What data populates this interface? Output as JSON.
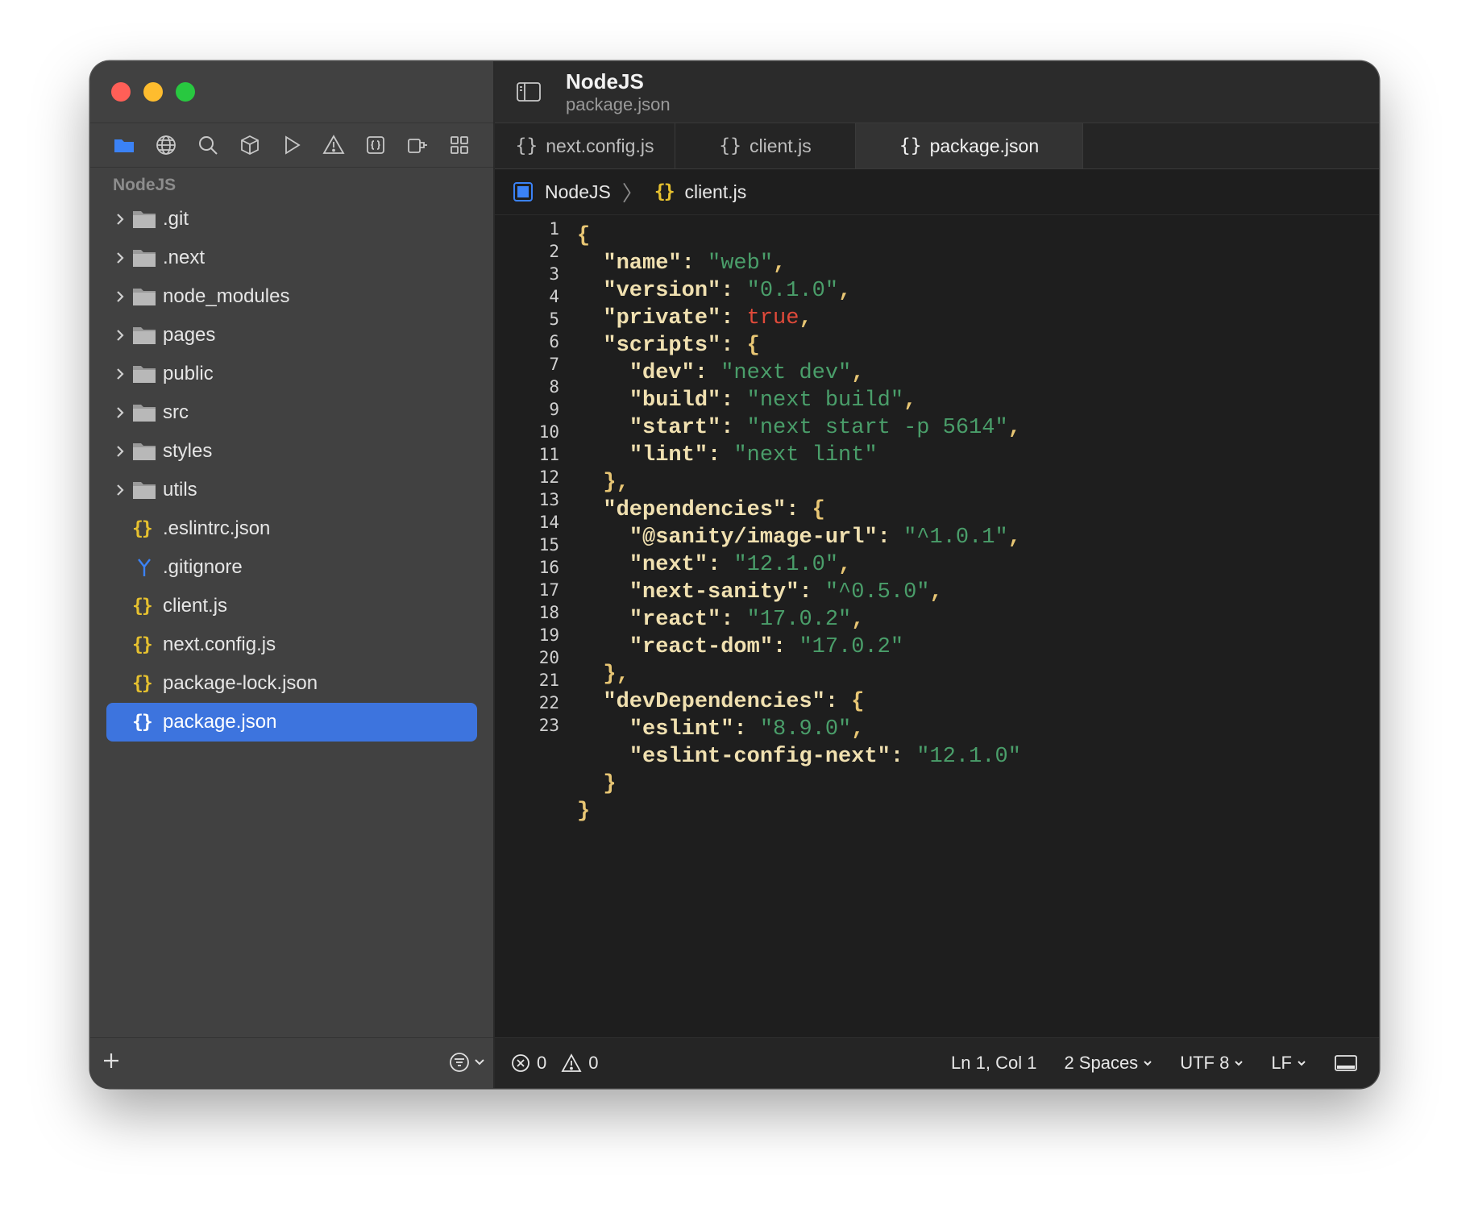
{
  "window": {
    "project_title": "NodeJS",
    "file_subtitle": "package.json"
  },
  "sidebar": {
    "project_label": "NodeJS",
    "navbar_icons": [
      "folder-icon",
      "globe-icon",
      "search-icon",
      "package-icon",
      "run-icon",
      "warning-icon",
      "braces-icon",
      "plug-icon",
      "grid-icon"
    ],
    "items": [
      {
        "label": ".git",
        "type": "folder"
      },
      {
        "label": ".next",
        "type": "folder"
      },
      {
        "label": "node_modules",
        "type": "folder"
      },
      {
        "label": "pages",
        "type": "folder"
      },
      {
        "label": "public",
        "type": "folder"
      },
      {
        "label": "src",
        "type": "folder"
      },
      {
        "label": "styles",
        "type": "folder"
      },
      {
        "label": "utils",
        "type": "folder"
      },
      {
        "label": ".eslintrc.json",
        "type": "json"
      },
      {
        "label": ".gitignore",
        "type": "git"
      },
      {
        "label": "client.js",
        "type": "json"
      },
      {
        "label": "next.config.js",
        "type": "json"
      },
      {
        "label": "package-lock.json",
        "type": "json"
      },
      {
        "label": "package.json",
        "type": "json",
        "selected": true
      }
    ],
    "braces_glyph": "{}"
  },
  "tabs": [
    {
      "label": "next.config.js"
    },
    {
      "label": "client.js"
    },
    {
      "label": "package.json",
      "active": true
    }
  ],
  "breadcrumb": {
    "project": "NodeJS",
    "file": "client.js"
  },
  "editor": {
    "line_numbers": [
      "1",
      "2",
      "3",
      "4",
      "5",
      "6",
      "7",
      "8",
      "9",
      "10",
      "11",
      "12",
      "13",
      "14",
      "15",
      "16",
      "17",
      "18",
      "19",
      "20",
      "21",
      "22",
      "23"
    ],
    "lines": [
      "{",
      "  \"name\": \"web\",",
      "  \"version\": \"0.1.0\",",
      "  \"private\": true,",
      "  \"scripts\": {",
      "    \"dev\": \"next dev\",",
      "    \"build\": \"next build\",",
      "    \"start\": \"next start -p 5614\",",
      "    \"lint\": \"next lint\"",
      "  },",
      "  \"dependencies\": {",
      "    \"@sanity/image-url\": \"^1.0.1\",",
      "    \"next\": \"12.1.0\",",
      "    \"next-sanity\": \"^0.5.0\",",
      "    \"react\": \"17.0.2\",",
      "    \"react-dom\": \"17.0.2\"",
      "  },",
      "  \"devDependencies\": {",
      "    \"eslint\": \"8.9.0\",",
      "    \"eslint-config-next\": \"12.1.0\"",
      "  }",
      "}"
    ]
  },
  "statusbar": {
    "errors": "0",
    "warnings": "0",
    "cursor": "Ln 1, Col 1",
    "indent": "2 Spaces",
    "encoding": "UTF 8",
    "line_ending": "LF"
  },
  "colors": {
    "selection": "#3d74de",
    "string": "#4a9e6a",
    "boolean": "#e04a3a",
    "key": "#f0e0b0",
    "braces_icon": "#e6c12f"
  }
}
